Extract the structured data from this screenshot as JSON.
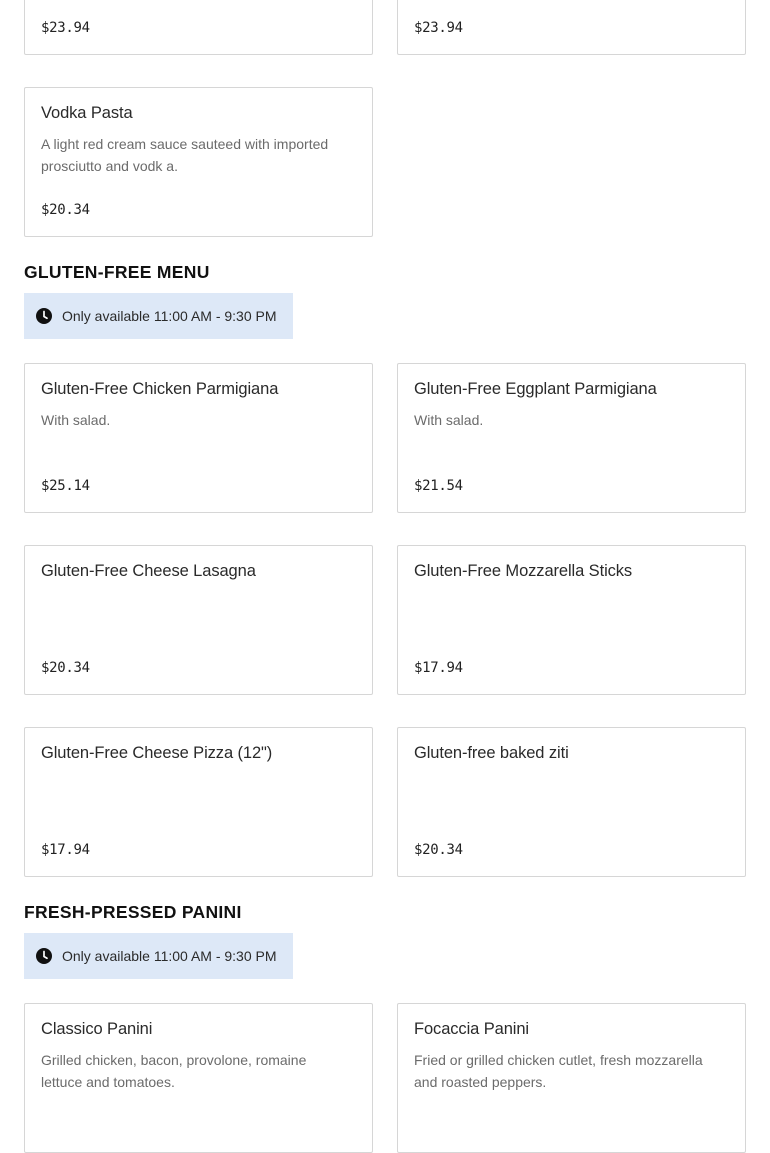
{
  "top_cards": [
    {
      "price": "$23.94"
    },
    {
      "price": "$23.94"
    }
  ],
  "vodka_pasta": {
    "name": "Vodka Pasta",
    "description": "A light red cream sauce sauteed with imported prosciutto and vodk a.",
    "price": "$20.34"
  },
  "gluten_free": {
    "title": "GLUTEN-FREE MENU",
    "hours": "Only available 11:00 AM - 9:30 PM",
    "items": [
      {
        "name": "Gluten-Free Chicken Parmigiana",
        "description": "With salad.",
        "price": "$25.14"
      },
      {
        "name": "Gluten-Free Eggplant Parmigiana",
        "description": "With salad.",
        "price": "$21.54"
      },
      {
        "name": "Gluten-Free Cheese Lasagna",
        "description": "",
        "price": "$20.34"
      },
      {
        "name": "Gluten-Free Mozzarella Sticks",
        "description": "",
        "price": "$17.94"
      },
      {
        "name": "Gluten-Free Cheese Pizza (12\")",
        "description": "",
        "price": "$17.94"
      },
      {
        "name": "Gluten-free baked ziti",
        "description": "",
        "price": "$20.34"
      }
    ]
  },
  "panini": {
    "title": "FRESH-PRESSED PANINI",
    "hours": "Only available 11:00 AM - 9:30 PM",
    "items": [
      {
        "name": "Classico Panini",
        "description": "Grilled chicken, bacon, provolone, romaine lettuce and tomatoes."
      },
      {
        "name": "Focaccia Panini",
        "description": "Fried or grilled chicken cutlet, fresh mozzarella and roasted peppers."
      }
    ]
  },
  "icons": {
    "hours_icon": "clock-icon"
  }
}
